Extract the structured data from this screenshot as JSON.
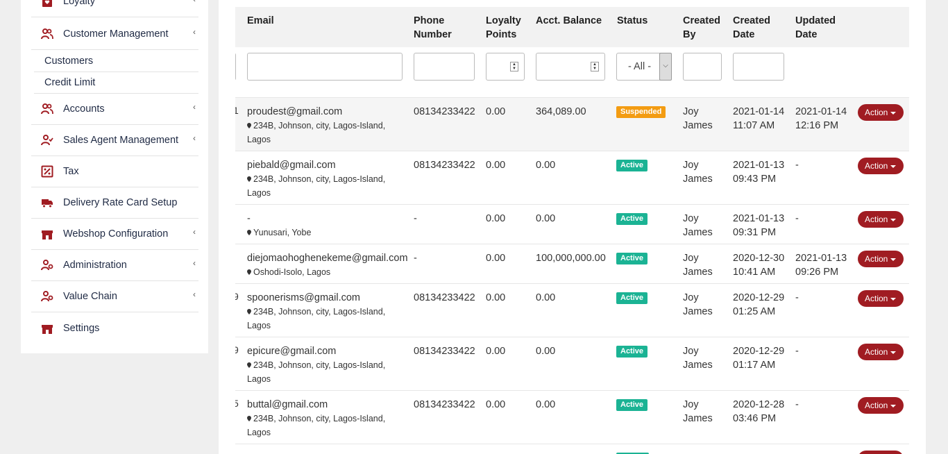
{
  "sidebar": {
    "items": [
      {
        "label": "Loyalty",
        "icon": "gift-icon",
        "chevron": "‹"
      },
      {
        "label": "Customer Management",
        "icon": "users-icon",
        "chevron": "‹"
      },
      {
        "label": "Accounts",
        "icon": "users-icon",
        "chevron": "‹"
      },
      {
        "label": "Sales Agent Management",
        "icon": "user-check-icon",
        "chevron": "‹"
      },
      {
        "label": "Tax",
        "icon": "percent-icon",
        "chevron": ""
      },
      {
        "label": "Delivery Rate Card Setup",
        "icon": "truck-icon",
        "chevron": ""
      },
      {
        "label": "Webshop Configuration",
        "icon": "store-icon",
        "chevron": "‹"
      },
      {
        "label": "Administration",
        "icon": "user-gear-icon",
        "chevron": "‹"
      },
      {
        "label": "Value Chain",
        "icon": "user-gear-icon",
        "chevron": "‹"
      },
      {
        "label": "Settings",
        "icon": "store-icon",
        "chevron": ""
      }
    ],
    "subitems": [
      {
        "label": "Customers"
      },
      {
        "label": "Credit Limit"
      }
    ],
    "accent_color": "#a01c22"
  },
  "table": {
    "headers": {
      "email": "Email",
      "phone": "Phone Number",
      "loyalty": "Loyalty Points",
      "balance": "Acct. Balance",
      "status": "Status",
      "created_by": "Created By",
      "created_date": "Created Date",
      "updated_date": "Updated Date"
    },
    "filters": {
      "status_select": "- All -"
    },
    "action_label": "Action",
    "rows": [
      {
        "email": "proudest@gmail.com",
        "address1": "234B, Johnson, city, Lagos-Island,",
        "address2": "Lagos",
        "phone": "08134233422",
        "loyalty": "0.00",
        "balance": "364,089.00",
        "status": "Suspended",
        "created_by_1": "Joy",
        "created_by_2": "James",
        "created_1": "2021-01-14",
        "created_2": "11:07 AM",
        "updated_1": "2021-01-14",
        "updated_2": "12:16 PM",
        "edge": "1"
      },
      {
        "email": "piebald@gmail.com",
        "address1": "234B, Johnson, city, Lagos-Island,",
        "address2": "Lagos",
        "phone": "08134233422",
        "loyalty": "0.00",
        "balance": "0.00",
        "status": "Active",
        "created_by_1": "Joy",
        "created_by_2": "James",
        "created_1": "2021-01-13",
        "created_2": "09:43 PM",
        "updated_1": "-",
        "updated_2": "",
        "edge": ""
      },
      {
        "email": "-",
        "address1": "Yunusari, Yobe",
        "address2": "",
        "phone": "-",
        "loyalty": "0.00",
        "balance": "0.00",
        "status": "Active",
        "created_by_1": "Joy",
        "created_by_2": "James",
        "created_1": "2021-01-13",
        "created_2": "09:31 PM",
        "updated_1": "-",
        "updated_2": "",
        "edge": ""
      },
      {
        "email": "diejomaohoghenekeme@gmail.com",
        "address1": "Oshodi-Isolo, Lagos",
        "address2": "",
        "phone": "-",
        "loyalty": "0.00",
        "balance": "100,000,000.00",
        "status": "Active",
        "created_by_1": "Joy",
        "created_by_2": "James",
        "created_1": "2020-12-30",
        "created_2": "10:41 AM",
        "updated_1": "2021-01-13",
        "updated_2": "09:26 PM",
        "edge": ""
      },
      {
        "email": "spoonerisms@gmail.com",
        "address1": "234B, Johnson, city, Lagos-Island,",
        "address2": "Lagos",
        "phone": "08134233422",
        "loyalty": "0.00",
        "balance": "0.00",
        "status": "Active",
        "created_by_1": "Joy",
        "created_by_2": "James",
        "created_1": "2020-12-29",
        "created_2": "01:25 AM",
        "updated_1": "-",
        "updated_2": "",
        "edge": "9"
      },
      {
        "email": "epicure@gmail.com",
        "address1": "234B, Johnson, city, Lagos-Island,",
        "address2": "Lagos",
        "phone": "08134233422",
        "loyalty": "0.00",
        "balance": "0.00",
        "status": "Active",
        "created_by_1": "Joy",
        "created_by_2": "James",
        "created_1": "2020-12-29",
        "created_2": "01:17 AM",
        "updated_1": "-",
        "updated_2": "",
        "edge": "9"
      },
      {
        "email": "buttal@gmail.com",
        "address1": "234B, Johnson, city, Lagos-Island,",
        "address2": "Lagos",
        "phone": "08134233422",
        "loyalty": "0.00",
        "balance": "0.00",
        "status": "Active",
        "created_by_1": "Joy",
        "created_by_2": "James",
        "created_1": "2020-12-28",
        "created_2": "03:46 PM",
        "updated_1": "-",
        "updated_2": "",
        "edge": "5"
      }
    ]
  }
}
